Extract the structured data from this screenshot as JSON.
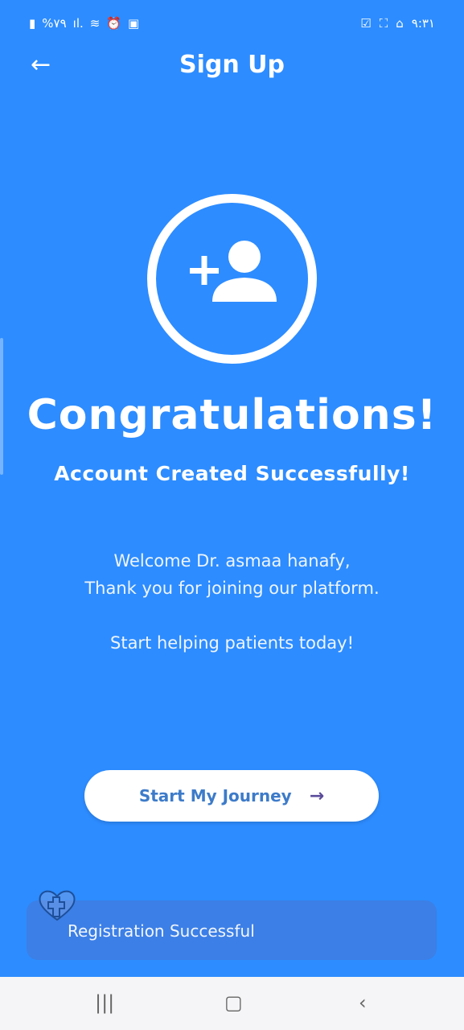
{
  "status_bar": {
    "battery": "%٧٩",
    "time": "٩:٣١"
  },
  "header": {
    "title": "Sign Up"
  },
  "main": {
    "heading": "Congratulations!",
    "subheading": "Account Created Successfully!",
    "welcome_line1": "Welcome Dr. asmaa hanafy,",
    "welcome_line2": "Thank you for joining our platform.",
    "cta_text": "Start helping patients today!",
    "button_label": "Start My Journey"
  },
  "toast": {
    "message": "Registration Successful"
  },
  "colors": {
    "background": "#2d8cff",
    "toast": "#3c7fe6",
    "button_text": "#3d7bc9"
  }
}
